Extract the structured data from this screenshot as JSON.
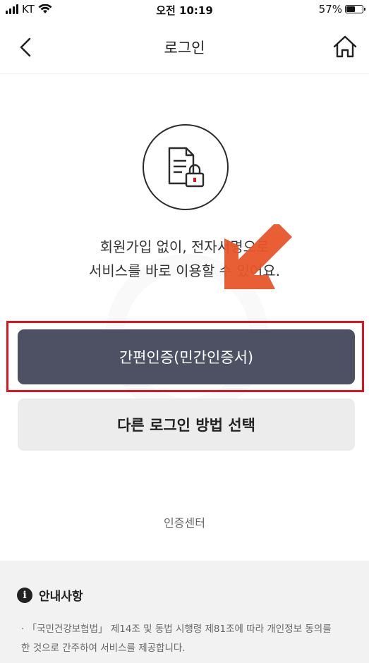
{
  "status_bar": {
    "carrier": "KT",
    "time": "오전 10:19",
    "battery_percent": "57%",
    "battery_level": 0.57,
    "icons": [
      "signal-icon",
      "wifi-icon",
      "battery-icon"
    ]
  },
  "nav": {
    "title": "로그인",
    "icons": [
      "back-chevron-icon",
      "home-icon"
    ]
  },
  "hero": {
    "icon": "document-lock-icon",
    "line1": "회원가입 없이, 전자서명으로",
    "line2": "서비스를 바로 이용할 수 있어요."
  },
  "annotation": {
    "arrow_icon": "arrow-icon",
    "arrow_color": "#e8562a",
    "highlight_color": "#e0141e"
  },
  "buttons": {
    "primary_label": "간편인증(민간인증서)",
    "secondary_label": "다른 로그인 방법 선택",
    "primary_color": "#4d5163"
  },
  "links": {
    "cert_center": "인증센터"
  },
  "notice": {
    "title": "안내사항",
    "icon": "info-icon",
    "text_line1": "· 「국민건강보험법」 제14조 및 동법 시행령 제81조에 따라 개인정보 동의를",
    "text_line2": "한 것으로 간주하여 서비스를 제공합니다."
  }
}
